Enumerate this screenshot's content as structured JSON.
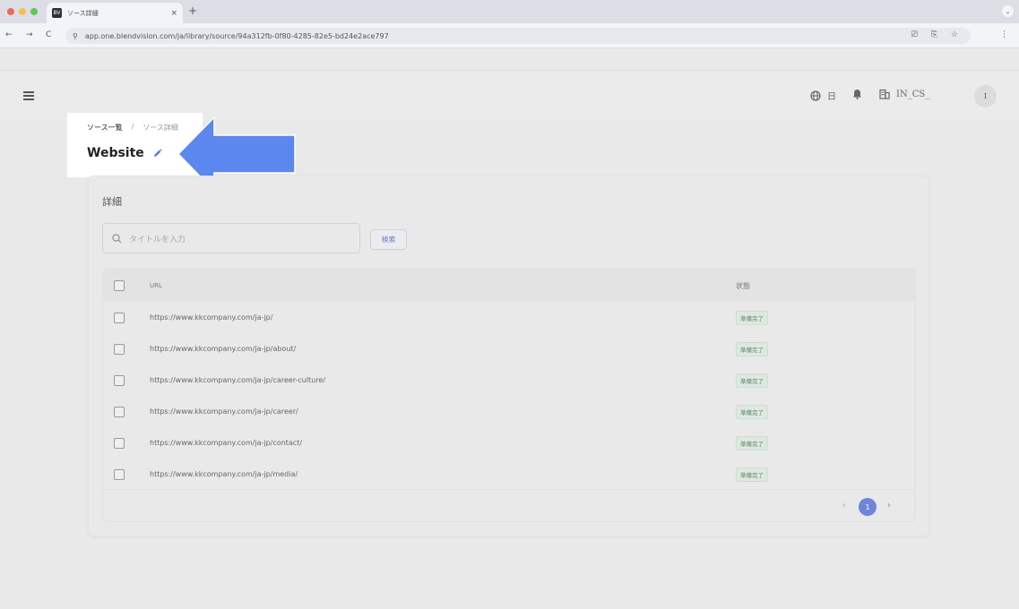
{
  "browser": {
    "tab_title": "ソース詳細",
    "favicon_text": "BV",
    "new_tab": "+",
    "tab_close": "×",
    "tab_menu": "⌄",
    "url": "app.one.blendvision.com/ja/library/source/94a312fb-0f80-4285-82e5-bd24e2ace797",
    "nav_back": "←",
    "nav_forward": "→",
    "nav_reload": "C",
    "site_info": "⚲",
    "omni_icons": "⎚ ⎘ ☆",
    "menu": "⋮",
    "traffic_colors": [
      "#ee6a5f",
      "#f5be4f",
      "#62c554"
    ]
  },
  "header": {
    "lang_label": "日",
    "org_label": "IN_CS_",
    "avatar_initial": "I"
  },
  "breadcrumb": {
    "parent": "ソース一覧",
    "separator": "/",
    "current": "ソース詳細"
  },
  "page": {
    "title": "Website"
  },
  "details": {
    "section_title": "詳細",
    "search_placeholder": "タイトルを入力",
    "search_button": "検索"
  },
  "table": {
    "headers": {
      "url": "URL",
      "status": "状態"
    },
    "rows": [
      {
        "url": "https://www.kkcompany.com/ja-jp/",
        "status": "準備完了"
      },
      {
        "url": "https://www.kkcompany.com/ja-jp/about/",
        "status": "準備完了"
      },
      {
        "url": "https://www.kkcompany.com/ja-jp/career-culture/",
        "status": "準備完了"
      },
      {
        "url": "https://www.kkcompany.com/ja-jp/career/",
        "status": "準備完了"
      },
      {
        "url": "https://www.kkcompany.com/ja-jp/contact/",
        "status": "準備完了"
      },
      {
        "url": "https://www.kkcompany.com/ja-jp/media/",
        "status": "準備完了"
      }
    ]
  },
  "pagination": {
    "prev": "‹",
    "current": "1",
    "next": "›"
  },
  "colors": {
    "accent": "#6d86d8",
    "arrow": "#5b87ee",
    "status_tag_bg": "#dfe8e0"
  }
}
